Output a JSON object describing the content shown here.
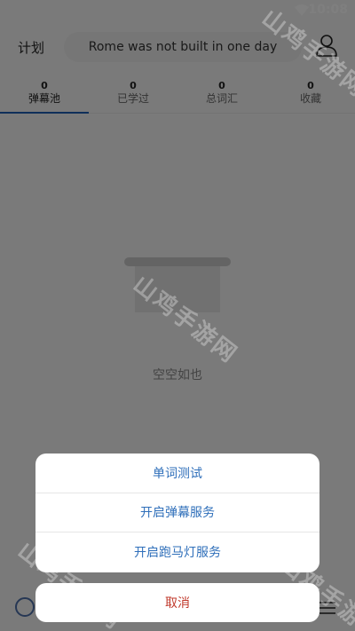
{
  "status": {
    "time": "10:08"
  },
  "header": {
    "plan_label": "计划",
    "quote": "Rome was not built in one day"
  },
  "tabs": [
    {
      "count": "0",
      "label": "弹幕池",
      "active": true
    },
    {
      "count": "0",
      "label": "已学过"
    },
    {
      "count": "0",
      "label": "总词汇"
    },
    {
      "count": "0",
      "label": "收藏"
    }
  ],
  "empty": {
    "message": "空空如也"
  },
  "action_sheet": {
    "items": [
      {
        "label": "单词测试"
      },
      {
        "label": "开启弹幕服务"
      },
      {
        "label": "开启跑马灯服务"
      }
    ],
    "cancel_label": "取消"
  },
  "watermark": {
    "text": "山鸡手游网"
  },
  "colors": {
    "accent": "#1e5fb4",
    "sheet_text": "#2f6fba",
    "cancel_text": "#c0392b"
  }
}
